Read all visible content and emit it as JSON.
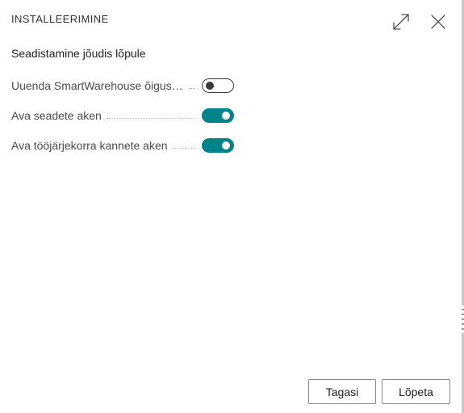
{
  "dialog": {
    "caption": "INSTALLEERIMINE",
    "subtitle": "Seadistamine jõudis lõpule"
  },
  "fields": [
    {
      "label": "Uuenda SmartWarehouse õigust...",
      "value": false
    },
    {
      "label": "Ava seadete aken",
      "value": true
    },
    {
      "label": "Ava tööjärjekorra kannete aken",
      "value": true
    }
  ],
  "buttons": {
    "back": "Tagasi",
    "finish": "Lõpeta"
  },
  "icons": {
    "expand": "expand-icon",
    "close": "close-icon"
  },
  "colors": {
    "toggle_on": "#00848a",
    "toggle_off_border": "#3a3a3a"
  }
}
